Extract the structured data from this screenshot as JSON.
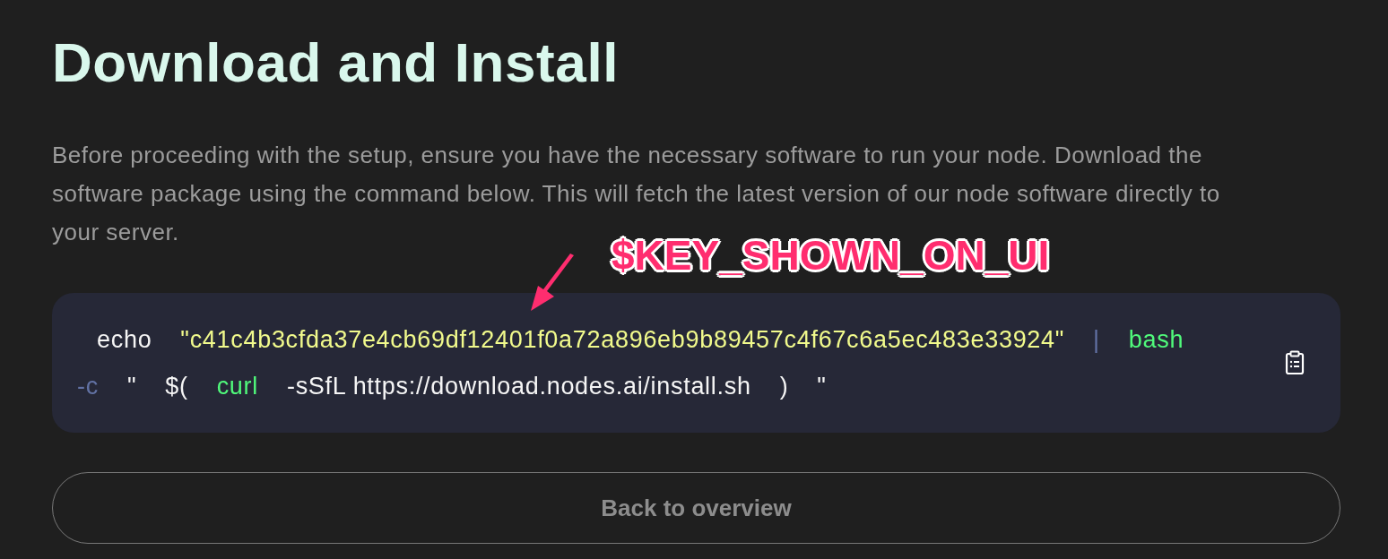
{
  "heading": "Download and Install",
  "description": "Before proceeding with the setup, ensure you have the necessary software to run your node. Download the software package using the command below. This will fetch the latest version of our node software directly to your server.",
  "annotation": {
    "text": "$KEY_SHOWN_ON_UI"
  },
  "command": {
    "tokens": [
      {
        "kind": "plain",
        "text": "echo"
      },
      {
        "kind": "string",
        "text": "\"c41c4b3cfda37e4cb69df12401f0a72a896eb9b89457c4f67c6a5ec483e33924\""
      },
      {
        "kind": "operator",
        "text": "|"
      },
      {
        "kind": "command",
        "text": "bash"
      },
      {
        "kind": "flag",
        "text": "-c"
      },
      {
        "kind": "plain",
        "text": "\""
      },
      {
        "kind": "plain",
        "text": "$("
      },
      {
        "kind": "command",
        "text": "curl"
      },
      {
        "kind": "plain",
        "text": "-sSfL https://download.nodes.ai/install.sh"
      },
      {
        "kind": "plain",
        "text": ")"
      },
      {
        "kind": "plain",
        "text": "\""
      }
    ]
  },
  "button": {
    "label": "Back to overview"
  }
}
